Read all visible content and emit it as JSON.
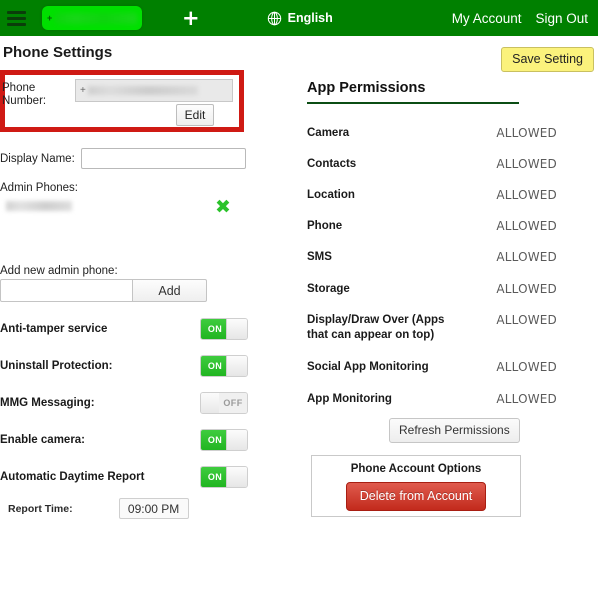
{
  "navbar": {
    "menu_icon": "hamburger-menu-icon",
    "phone_pill": {
      "prefix": "+",
      "value": "",
      "redacted": true
    },
    "add_label": "+",
    "language": {
      "icon": "globe-icon",
      "label": "English"
    },
    "my_account_label": "My Account",
    "sign_out_label": "Sign Out",
    "background_color": "#008000"
  },
  "page": {
    "title": "Phone Settings",
    "save_button_label": "Save Setting",
    "save_button_color": "#fbf27c"
  },
  "phone_number_block": {
    "highlight_color": "#cf1a14",
    "label": "Phone Number:",
    "value_prefix": "+",
    "value": "",
    "redacted": true,
    "edit_button_label": "Edit"
  },
  "display_name": {
    "label": "Display Name:",
    "value": "",
    "placeholder": ""
  },
  "admin_phones": {
    "label": "Admin Phones:",
    "entries": [
      {
        "value": "",
        "redacted": true,
        "delete_icon": "green-x-icon"
      }
    ],
    "add_label": "Add new admin phone:",
    "add_input_value": "",
    "add_input_placeholder": "",
    "add_button_label": "Add"
  },
  "toggles": [
    {
      "label": "Anti-tamper service",
      "state": "ON",
      "on_text": "ON",
      "off_text": "OFF"
    },
    {
      "label": "Uninstall Protection:",
      "state": "ON",
      "on_text": "ON",
      "off_text": "OFF"
    },
    {
      "label": "MMG Messaging:",
      "state": "OFF",
      "on_text": "ON",
      "off_text": "OFF"
    },
    {
      "label": "Enable camera:",
      "state": "ON",
      "on_text": "ON",
      "off_text": "OFF"
    },
    {
      "label": "Automatic Daytime Report",
      "state": "ON",
      "on_text": "ON",
      "off_text": "OFF"
    }
  ],
  "report_time": {
    "label": "Report Time:",
    "value": "09:00 PM"
  },
  "app_permissions": {
    "title": "App Permissions",
    "rule_color": "#0b4d14",
    "items": [
      {
        "name": "Camera",
        "status": "ALLOWED"
      },
      {
        "name": "Contacts",
        "status": "ALLOWED"
      },
      {
        "name": "Location",
        "status": "ALLOWED"
      },
      {
        "name": "Phone",
        "status": "ALLOWED"
      },
      {
        "name": "SMS",
        "status": "ALLOWED"
      },
      {
        "name": "Storage",
        "status": "ALLOWED"
      },
      {
        "name": "Display/Draw Over (Apps that can appear on top)",
        "status": "ALLOWED"
      },
      {
        "name": "Social App Monitoring",
        "status": "ALLOWED"
      },
      {
        "name": "App Monitoring",
        "status": "ALLOWED"
      }
    ],
    "refresh_button_label": "Refresh Permissions"
  },
  "account_options": {
    "title": "Phone Account Options",
    "delete_button_label": "Delete from Account",
    "delete_button_color": "#c22a1c"
  }
}
